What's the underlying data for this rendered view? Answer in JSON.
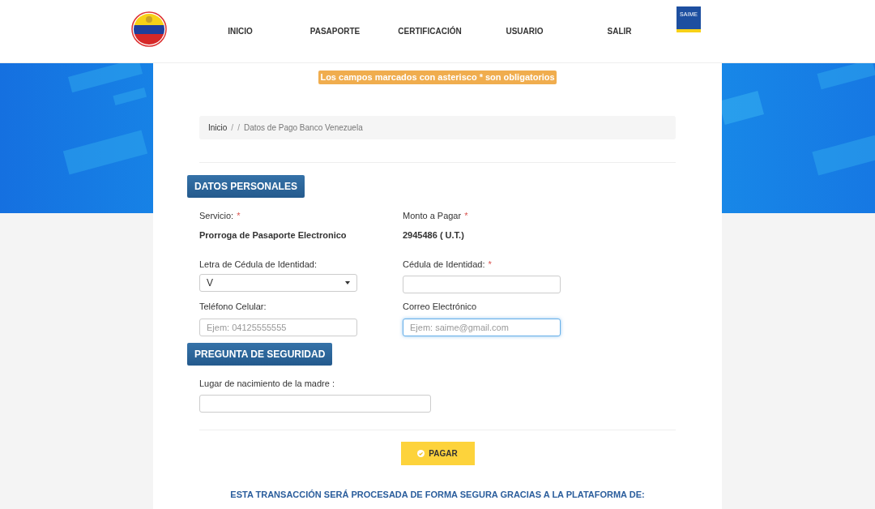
{
  "header": {
    "nav": [
      {
        "label": "INICIO"
      },
      {
        "label": "PASAPORTE"
      },
      {
        "label": "CERTIFICACIÓN"
      },
      {
        "label": "USUARIO"
      },
      {
        "label": "SALIR"
      }
    ],
    "brand_logo": {
      "text": "SAIME"
    }
  },
  "notice": "Los campos marcados con asterisco * son obligatorios",
  "breadcrumb": [
    {
      "kind": "link",
      "text": "Inicio"
    },
    {
      "kind": "separator",
      "text": "/"
    },
    {
      "kind": "separator",
      "text": "/"
    },
    {
      "kind": "current",
      "text": "Datos de Pago Banco Venezuela"
    }
  ],
  "sections": [
    {
      "title": "DATOS PERSONALES",
      "kind": "grid",
      "fields": [
        {
          "kind": "static",
          "label": "Servicio:",
          "required_mark": "*",
          "value": "Prorroga de Pasaporte Electronico"
        },
        {
          "kind": "static",
          "label": "Monto a Pagar",
          "required_mark": "*",
          "value": "2945486 ( U.T.)"
        },
        {
          "kind": "select",
          "label": "Letra de Cédula de Identidad:",
          "value": "V"
        },
        {
          "kind": "input",
          "label": "Cédula de Identidad:",
          "required_mark": "*",
          "focused": false
        },
        {
          "kind": "input",
          "label": "Teléfono Celular:",
          "placeholder": "Ejem: 04125555555",
          "focused": false
        },
        {
          "kind": "input",
          "label": "Correo Electrónico",
          "placeholder": "Ejem: saime@gmail.com",
          "focused": true
        }
      ]
    },
    {
      "title": "PREGUNTA DE SEGURIDAD",
      "kind": "stack",
      "fields": [
        {
          "kind": "input",
          "label": "Lugar de nacimiento de la madre :",
          "focused": false
        }
      ]
    }
  ],
  "submit": {
    "label": "PAGAR"
  },
  "footer_note": "ESTA TRANSACCIÓN SERÁ PROCESADA DE FORMA SEGURA GRACIAS A LA PLATAFORMA DE:"
}
